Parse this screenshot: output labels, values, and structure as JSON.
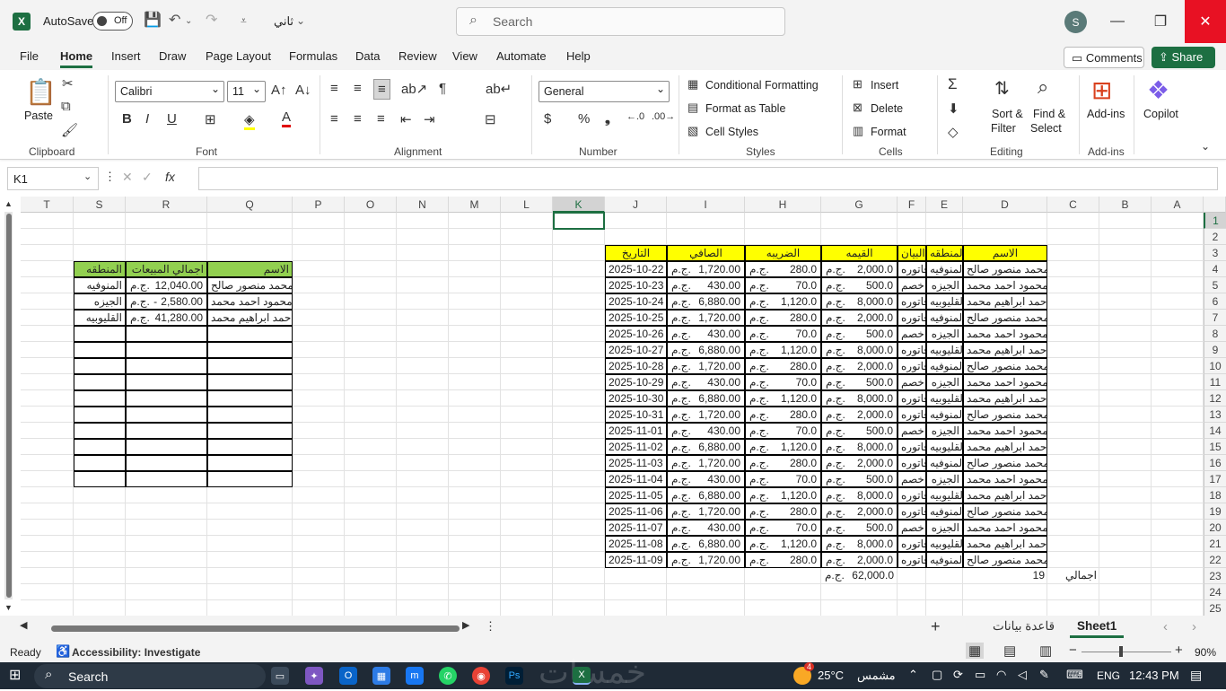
{
  "titlebar": {
    "autosave_label": "AutoSave",
    "toggle_state": "Off",
    "filename": "ثاني",
    "search_placeholder": "Search",
    "user_initial": "S"
  },
  "tabs": [
    "File",
    "Home",
    "Insert",
    "Draw",
    "Page Layout",
    "Formulas",
    "Data",
    "Review",
    "View",
    "Automate",
    "Help"
  ],
  "actions": {
    "comments": "Comments",
    "share": "Share"
  },
  "ribbon": {
    "clipboard": {
      "label": "Clipboard",
      "paste": "Paste"
    },
    "font": {
      "label": "Font",
      "name": "Calibri",
      "size": "11"
    },
    "alignment": {
      "label": "Alignment"
    },
    "number": {
      "label": "Number",
      "format": "General"
    },
    "styles": {
      "label": "Styles",
      "conditional": "Conditional Formatting",
      "format_table": "Format as Table",
      "cell_styles": "Cell Styles"
    },
    "cells": {
      "label": "Cells",
      "insert": "Insert",
      "delete": "Delete",
      "format": "Format"
    },
    "editing": {
      "label": "Editing",
      "sort": "Sort &",
      "sort2": "Filter",
      "find": "Find &",
      "find2": "Select"
    },
    "addins": {
      "label": "Add-ins",
      "addins": "Add-ins"
    },
    "copilot": {
      "label": "Copilot"
    }
  },
  "formula_bar": {
    "name_box": "K1",
    "formula": ""
  },
  "columns": [
    "T",
    "S",
    "R",
    "Q",
    "P",
    "O",
    "N",
    "M",
    "L",
    "K",
    "J",
    "I",
    "H",
    "G",
    "F",
    "E",
    "D",
    "C",
    "B",
    "A"
  ],
  "rows": [
    "1",
    "2",
    "3",
    "4",
    "5",
    "6",
    "7",
    "8",
    "9",
    "10",
    "11",
    "12",
    "13",
    "14",
    "15",
    "16",
    "17",
    "18",
    "19",
    "20",
    "21",
    "22",
    "23",
    "24",
    "25"
  ],
  "main_table": {
    "headers": {
      "name": "الاسم",
      "region": "المنطقه",
      "desc": "البيان",
      "value": "القيمه",
      "tax": "الضريبه",
      "net": "الصافي",
      "date": "التاريخ"
    },
    "rows": [
      {
        "name": "محمد منصور صالح",
        "region": "المنوفيه",
        "desc": "فاتوره",
        "value": "2,000.0",
        "tax": "280.0",
        "net": "1,720.00",
        "date": "2025-10-22"
      },
      {
        "name": "محمود احمد محمد",
        "region": "الجيزه",
        "desc": "خصم",
        "value": "500.0",
        "tax": "70.0",
        "net": "430.00",
        "date": "2025-10-23"
      },
      {
        "name": "احمد ابراهيم محمد",
        "region": "القليوبيه",
        "desc": "فاتوره",
        "value": "8,000.0",
        "tax": "1,120.0",
        "net": "6,880.00",
        "date": "2025-10-24"
      },
      {
        "name": "محمد منصور صالح",
        "region": "المنوفيه",
        "desc": "فاتوره",
        "value": "2,000.0",
        "tax": "280.0",
        "net": "1,720.00",
        "date": "2025-10-25"
      },
      {
        "name": "محمود احمد محمد",
        "region": "الجيزه",
        "desc": "خصم",
        "value": "500.0",
        "tax": "70.0",
        "net": "430.00",
        "date": "2025-10-26"
      },
      {
        "name": "احمد ابراهيم محمد",
        "region": "القليوبيه",
        "desc": "فاتوره",
        "value": "8,000.0",
        "tax": "1,120.0",
        "net": "6,880.00",
        "date": "2025-10-27"
      },
      {
        "name": "محمد منصور صالح",
        "region": "المنوفيه",
        "desc": "فاتوره",
        "value": "2,000.0",
        "tax": "280.0",
        "net": "1,720.00",
        "date": "2025-10-28"
      },
      {
        "name": "محمود احمد محمد",
        "region": "الجيزه",
        "desc": "خصم",
        "value": "500.0",
        "tax": "70.0",
        "net": "430.00",
        "date": "2025-10-29"
      },
      {
        "name": "احمد ابراهيم محمد",
        "region": "القليوبيه",
        "desc": "فاتوره",
        "value": "8,000.0",
        "tax": "1,120.0",
        "net": "6,880.00",
        "date": "2025-10-30"
      },
      {
        "name": "محمد منصور صالح",
        "region": "المنوفيه",
        "desc": "فاتوره",
        "value": "2,000.0",
        "tax": "280.0",
        "net": "1,720.00",
        "date": "2025-10-31"
      },
      {
        "name": "محمود احمد محمد",
        "region": "الجيزه",
        "desc": "خصم",
        "value": "500.0",
        "tax": "70.0",
        "net": "430.00",
        "date": "2025-11-01"
      },
      {
        "name": "احمد ابراهيم محمد",
        "region": "القليوبيه",
        "desc": "فاتوره",
        "value": "8,000.0",
        "tax": "1,120.0",
        "net": "6,880.00",
        "date": "2025-11-02"
      },
      {
        "name": "محمد منصور صالح",
        "region": "المنوفيه",
        "desc": "فاتوره",
        "value": "2,000.0",
        "tax": "280.0",
        "net": "1,720.00",
        "date": "2025-11-03"
      },
      {
        "name": "محمود احمد محمد",
        "region": "الجيزه",
        "desc": "خصم",
        "value": "500.0",
        "tax": "70.0",
        "net": "430.00",
        "date": "2025-11-04"
      },
      {
        "name": "احمد ابراهيم محمد",
        "region": "القليوبيه",
        "desc": "فاتوره",
        "value": "8,000.0",
        "tax": "1,120.0",
        "net": "6,880.00",
        "date": "2025-11-05"
      },
      {
        "name": "محمد منصور صالح",
        "region": "المنوفيه",
        "desc": "فاتوره",
        "value": "2,000.0",
        "tax": "280.0",
        "net": "1,720.00",
        "date": "2025-11-06"
      },
      {
        "name": "محمود احمد محمد",
        "region": "الجيزه",
        "desc": "خصم",
        "value": "500.0",
        "tax": "70.0",
        "net": "430.00",
        "date": "2025-11-07"
      },
      {
        "name": "احمد ابراهيم محمد",
        "region": "القليوبيه",
        "desc": "فاتوره",
        "value": "8,000.0",
        "tax": "1,120.0",
        "net": "6,880.00",
        "date": "2025-11-08"
      },
      {
        "name": "محمد منصور صالح",
        "region": "المنوفيه",
        "desc": "فاتوره",
        "value": "2,000.0",
        "tax": "280.0",
        "net": "1,720.00",
        "date": "2025-11-09"
      }
    ],
    "currency": "ج.م.",
    "total_label": "اجمالي",
    "total_count": "19",
    "total_value": "62,000.0"
  },
  "summary_table": {
    "headers": {
      "name": "الاسم",
      "sales": "اجمالي المبيعات",
      "region": "المنطقه"
    },
    "rows": [
      {
        "name": "محمد منصور صالح",
        "sales": "12,040.00",
        "region": "المنوفيه"
      },
      {
        "name": "محمود احمد محمد",
        "sales": "2,580.00",
        "sales_sign": "-",
        "region": "الجيزه"
      },
      {
        "name": "احمد ابراهيم محمد",
        "sales": "41,280.00",
        "region": "القليوبيه"
      }
    ]
  },
  "sheets": {
    "active": "Sheet1",
    "other": "قاعدة بيانات"
  },
  "status": {
    "ready": "Ready",
    "accessibility": "Accessibility: Investigate",
    "zoom": "90%"
  },
  "taskbar": {
    "search": "Search",
    "weather_temp": "25°C",
    "weather_text": "مشمس",
    "weather_badge": "4",
    "lang": "ENG",
    "time": "12:43 PM",
    "watermark": "خمسات"
  }
}
